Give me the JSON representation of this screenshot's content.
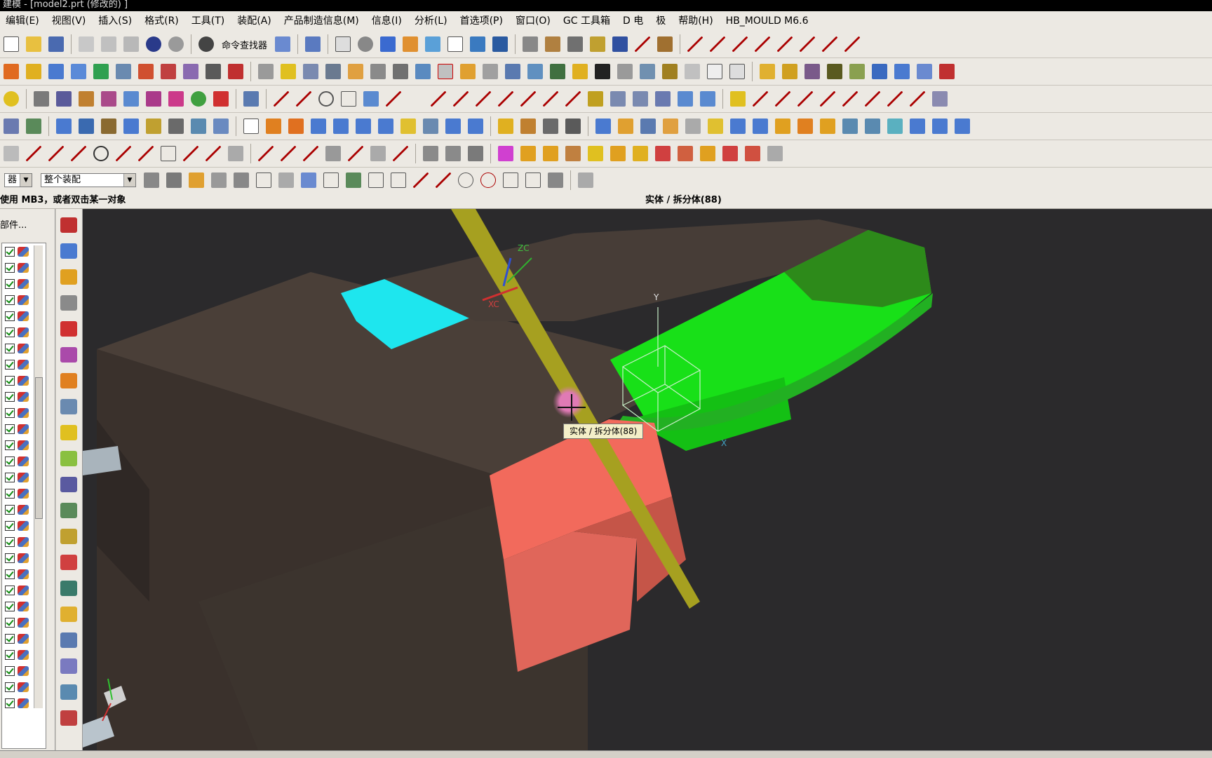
{
  "window": {
    "title": "建模 - [model2.prt (修改的) ]"
  },
  "menu": [
    "编辑(E)",
    "视图(V)",
    "插入(S)",
    "格式(R)",
    "工具(T)",
    "装配(A)",
    "产品制造信息(M)",
    "信息(I)",
    "分析(L)",
    "首选项(P)",
    "窗口(O)",
    "GC 工具箱",
    "D 电",
    "极",
    "帮助(H)",
    "HB_MOULD M6.6"
  ],
  "toolbar": {
    "command_finder_label": "命令查找器"
  },
  "selection": {
    "filter_value": "器",
    "scope_value": "整个装配"
  },
  "cue_line": {
    "prompt": "使用 MB3，或者双击某一对象",
    "status": "实体 / 拆分体(88)"
  },
  "navigator": {
    "title": "部件...",
    "row_count": 29
  },
  "viewport": {
    "tooltip": "实体 / 拆分体(88)",
    "labels": {
      "xc": "XC",
      "zc": "ZC",
      "y": "Y",
      "x": "X"
    },
    "colors": {
      "background": "#2b2a2c",
      "base_body": "#4a3f38",
      "selected_face": "#f26a5c",
      "green_body": "#18e018",
      "cyan_face": "#1ee6ee",
      "datum_plane": "#a6a020"
    }
  }
}
